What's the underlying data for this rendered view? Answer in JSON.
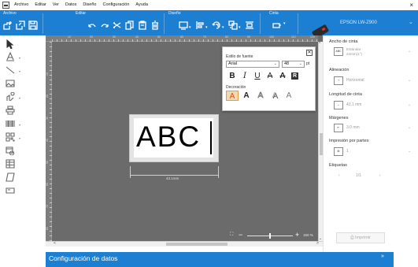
{
  "menu": {
    "items": [
      "Archivo",
      "Editar",
      "Ver",
      "Datos",
      "Diseño",
      "Configuración",
      "Ayuda"
    ],
    "close": "×"
  },
  "ribbon": {
    "groups": {
      "archivo": "Archivo",
      "editar": "Editar",
      "diseno": "Diseño",
      "cinta": "Cinta"
    },
    "printer": "EPSON LW-Z900"
  },
  "canvas": {
    "label_text": "ABC",
    "tape_length": "43.1mm",
    "ruler_numbers": [
      "10",
      "20",
      "30",
      "40",
      "50",
      "60",
      "70",
      "80",
      "90",
      "100",
      "110",
      "120",
      "130",
      "140",
      "150",
      "160",
      "170",
      "180"
    ],
    "zoom_value": "150 %"
  },
  "font_popup": {
    "title": "Estilo de fuente",
    "close": "✕",
    "font": "Arial",
    "size": "48",
    "unit": "pt",
    "styles": [
      "B",
      "I",
      "U",
      "A",
      "A",
      "R"
    ],
    "decoration_label": "Decoración",
    "decorations": [
      "A",
      "A",
      "A",
      "A",
      "A"
    ]
  },
  "right_panel": {
    "tape_width_label": "Ancho de cinta",
    "tape_width_box": "ABC",
    "tape_width_value_1": "Estándar",
    "tape_width_value_2": "24mm(1\")",
    "alignment_label": "Alineación",
    "alignment_value": "Horizontal",
    "tape_length_label": "Longitud de cinta",
    "tape_length_value": "43.1 mm",
    "margins_label": "Márgenes",
    "margins_value": "3.0 mm",
    "print_parts_label": "Impresión por partes",
    "print_parts_value": "1",
    "labels_label": "Etiquetas",
    "labels_pager": "1/1",
    "print_button": "Imprimir"
  },
  "bottom": {
    "title": "Configuración de datos",
    "expand": "»"
  },
  "colors": {
    "accent": "#1d7fd1",
    "canvas": "#6b6b6b",
    "active_decoration": "#f6d8b0"
  }
}
